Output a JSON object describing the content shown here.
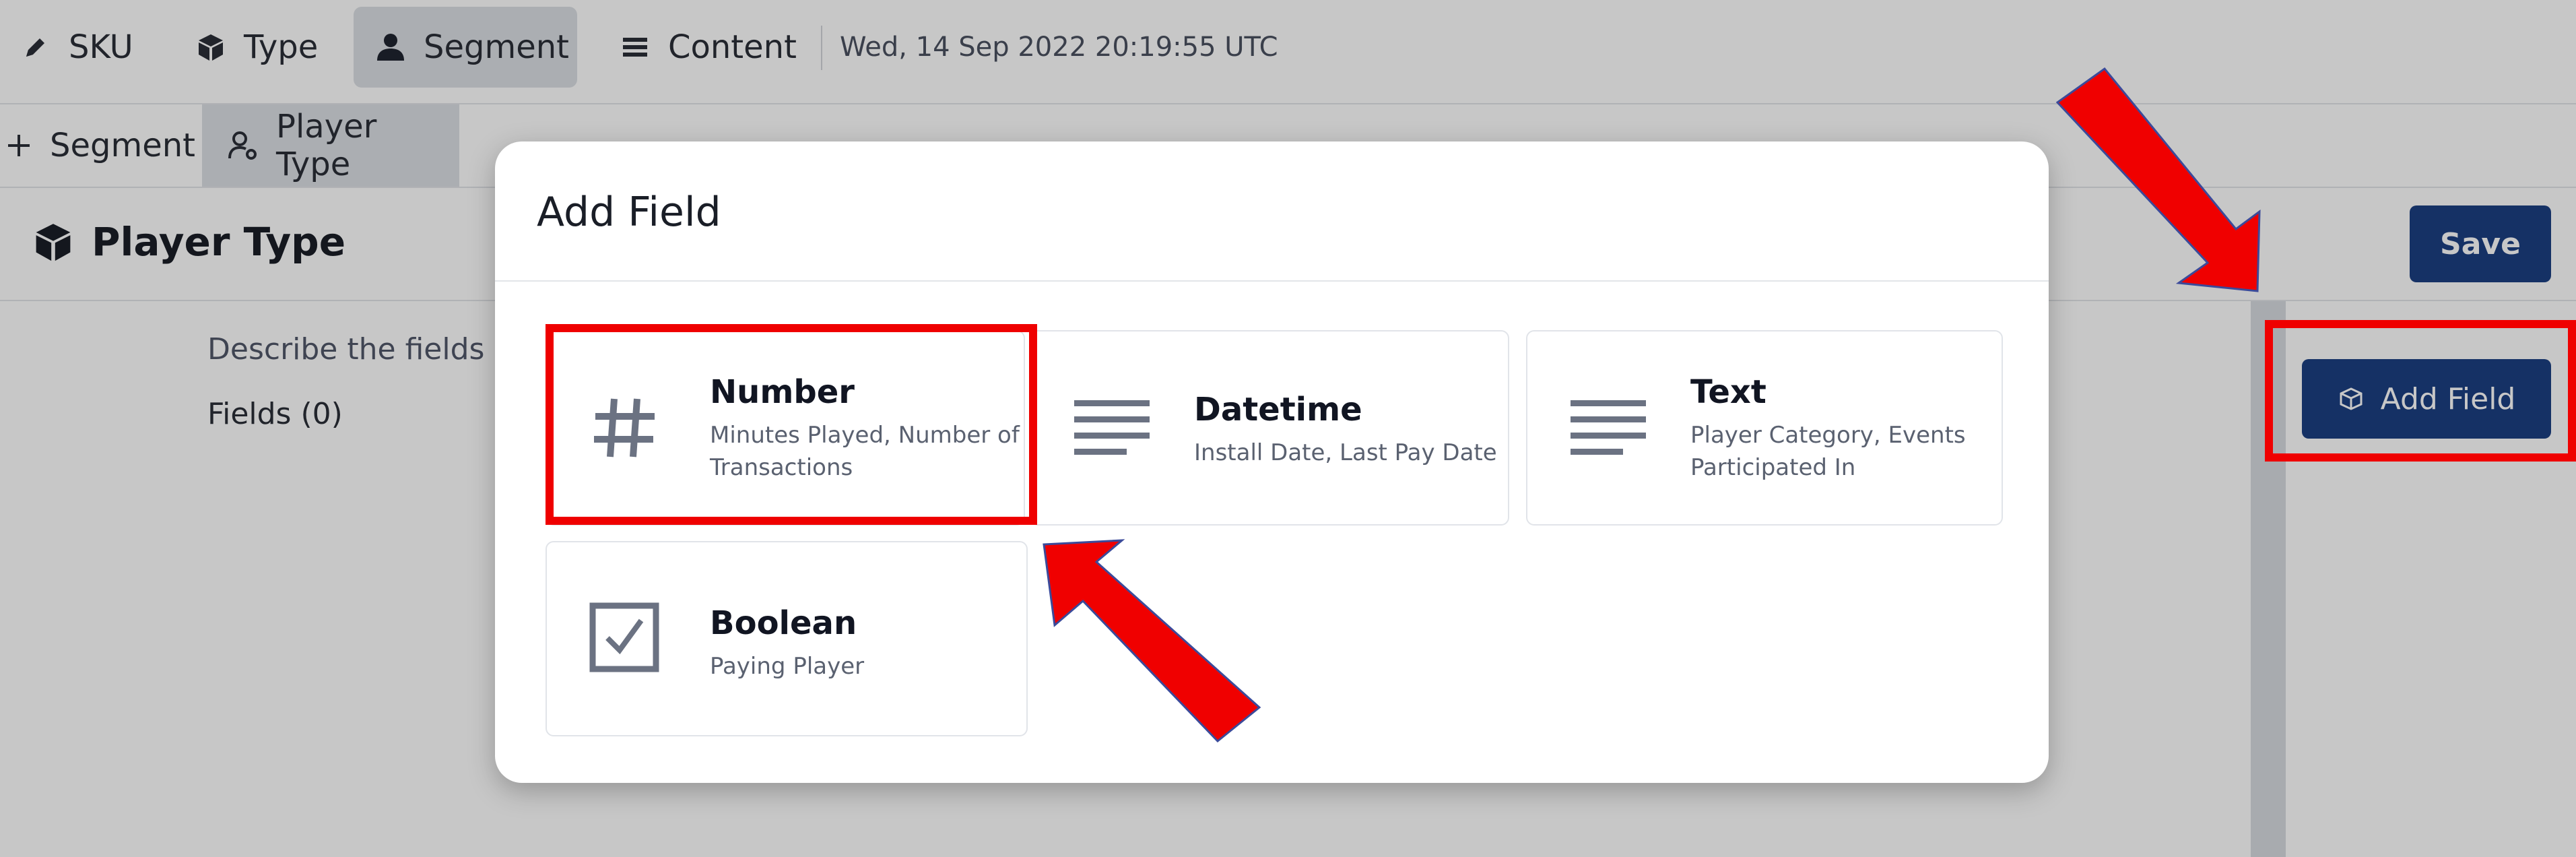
{
  "nav": {
    "tabs": [
      {
        "label": "SKU",
        "icon": "pencil-icon"
      },
      {
        "label": "Type",
        "icon": "cube-icon"
      },
      {
        "label": "Segment",
        "icon": "person-icon",
        "active": true
      },
      {
        "label": "Content",
        "icon": "list-icon"
      }
    ],
    "timestamp": "Wed, 14 Sep 2022 20:19:55 UTC"
  },
  "subtabs": [
    {
      "label": "Segment",
      "icon": "plus-icon"
    },
    {
      "label": "Player Type",
      "icon": "person-gear-icon",
      "active": true
    }
  ],
  "page": {
    "title": "Player Type",
    "save_label": "Save",
    "description": "Describe the fields o",
    "fields_count": "Fields (0)",
    "add_field_label": "Add Field"
  },
  "modal": {
    "title": "Add Field",
    "options": [
      {
        "name": "Number",
        "description": "Minutes Played, Number of Transactions",
        "desc_line1": "Minutes Played, Number of",
        "desc_line2": "Transactions",
        "icon": "hash-icon"
      },
      {
        "name": "Datetime",
        "description": "Install Date, Last Pay Date",
        "icon": "lines-icon"
      },
      {
        "name": "Text",
        "description": "Player Category, Events Participated In",
        "desc_line1": "Player Category, Events",
        "desc_line2": "Participated In",
        "icon": "lines-icon"
      },
      {
        "name": "Boolean",
        "description": "Paying Player",
        "icon": "checkbox-icon"
      }
    ]
  },
  "colors": {
    "primary_button": "#1c3f82",
    "annotation_red": "#ef0000",
    "active_tab_bg": "#dcdfe5"
  }
}
